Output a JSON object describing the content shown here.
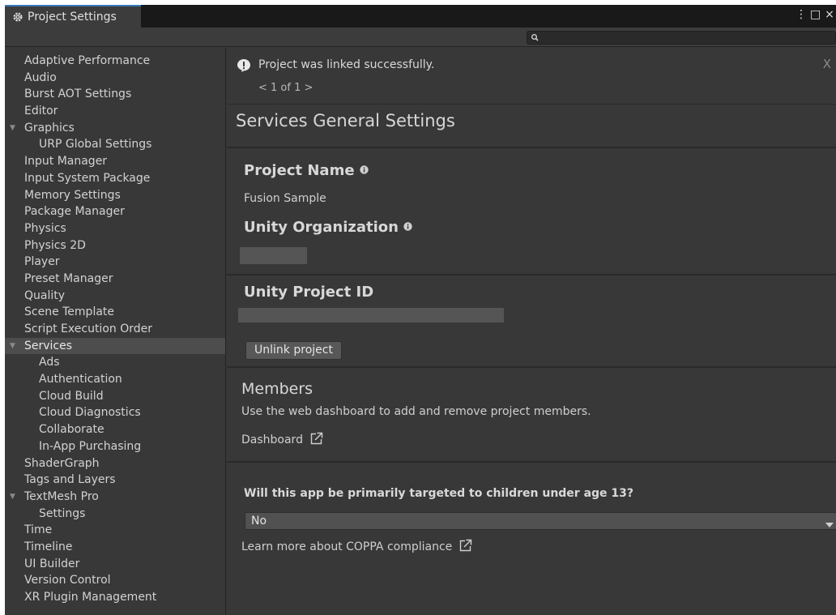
{
  "window": {
    "tab_title": "Project Settings",
    "controls": [
      "⋮",
      "□",
      "×"
    ]
  },
  "search": {
    "placeholder": ""
  },
  "sidebar": {
    "items": [
      {
        "label": "Adaptive Performance",
        "level": 0
      },
      {
        "label": "Audio",
        "level": 0
      },
      {
        "label": "Burst AOT Settings",
        "level": 0
      },
      {
        "label": "Editor",
        "level": 0
      },
      {
        "label": "Graphics",
        "level": 0,
        "expanded": true
      },
      {
        "label": "URP Global Settings",
        "level": 1
      },
      {
        "label": "Input Manager",
        "level": 0
      },
      {
        "label": "Input System Package",
        "level": 0
      },
      {
        "label": "Memory Settings",
        "level": 0
      },
      {
        "label": "Package Manager",
        "level": 0
      },
      {
        "label": "Physics",
        "level": 0
      },
      {
        "label": "Physics 2D",
        "level": 0
      },
      {
        "label": "Player",
        "level": 0
      },
      {
        "label": "Preset Manager",
        "level": 0
      },
      {
        "label": "Quality",
        "level": 0
      },
      {
        "label": "Scene Template",
        "level": 0
      },
      {
        "label": "Script Execution Order",
        "level": 0
      },
      {
        "label": "Services",
        "level": 0,
        "expanded": true,
        "selected": true
      },
      {
        "label": "Ads",
        "level": 1
      },
      {
        "label": "Authentication",
        "level": 1
      },
      {
        "label": "Cloud Build",
        "level": 1
      },
      {
        "label": "Cloud Diagnostics",
        "level": 1
      },
      {
        "label": "Collaborate",
        "level": 1
      },
      {
        "label": "In-App Purchasing",
        "level": 1
      },
      {
        "label": "ShaderGraph",
        "level": 0
      },
      {
        "label": "Tags and Layers",
        "level": 0
      },
      {
        "label": "TextMesh Pro",
        "level": 0,
        "expanded": true
      },
      {
        "label": "Settings",
        "level": 1
      },
      {
        "label": "Time",
        "level": 0
      },
      {
        "label": "Timeline",
        "level": 0
      },
      {
        "label": "UI Builder",
        "level": 0
      },
      {
        "label": "Version Control",
        "level": 0
      },
      {
        "label": "XR Plugin Management",
        "level": 0
      }
    ]
  },
  "notification": {
    "message": "Project was linked successfully.",
    "pager": "< 1 of 1 >",
    "close": "X"
  },
  "main": {
    "title": "Services General Settings",
    "project_name_label": "Project Name",
    "project_name_value": "Fusion Sample",
    "organization_label": "Unity Organization",
    "project_id_label": "Unity Project ID",
    "unlink_button": "Unlink project",
    "members_heading": "Members",
    "members_description": "Use the web dashboard to add and remove project members.",
    "dashboard_link": "Dashboard",
    "coppa_question": "Will this app be primarily targeted to children under age 13?",
    "coppa_selected": "No",
    "coppa_link": "Learn more about COPPA compliance"
  },
  "colors": {
    "accent": "#3a79bb",
    "panel_bg": "#383838",
    "selected_bg": "#4d4d4d"
  }
}
